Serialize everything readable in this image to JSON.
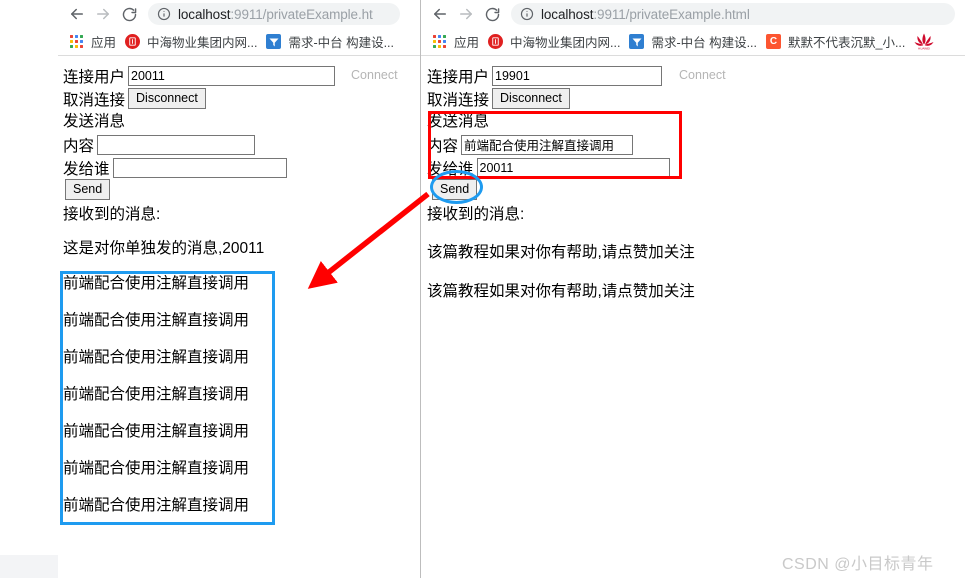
{
  "windows": {
    "left": {
      "nav": {
        "back_icon": "arrow-left-icon",
        "forward_icon": "arrow-right-icon",
        "reload_icon": "reload-icon"
      },
      "omnibox": {
        "info_icon": "info-circle-icon",
        "url_host": "localhost",
        "url_rest": ":9911/privateExample.ht"
      },
      "bookmarks": [
        {
          "icon": "apps-grid-icon",
          "label": "应用"
        },
        {
          "icon": "zhonghai-favicon",
          "label": "中海物业集团内网...",
          "letter": "",
          "color": "#e02020"
        },
        {
          "icon": "xuqiu-favicon",
          "label": "需求-中台 构建设...",
          "letter": "",
          "color": "#2f7fd1"
        }
      ],
      "page": {
        "connect_label": "连接用户",
        "connect_value": "20011",
        "connect_button": "Connect",
        "disconnect_label": "取消连接",
        "disconnect_button": "Disconnect",
        "send_section_label": "发送消息",
        "content_label": "内容",
        "content_value": "",
        "content_placeholder": "",
        "to_label": "发给谁",
        "to_value": "",
        "to_placeholder": "",
        "send_button": "Send",
        "received_label": "接收到的消息:",
        "first_message": "这是对你单独发的消息,20011",
        "boxed_messages": [
          "前端配合使用注解直接调用",
          "前端配合使用注解直接调用",
          "前端配合使用注解直接调用",
          "前端配合使用注解直接调用",
          "前端配合使用注解直接调用",
          "前端配合使用注解直接调用",
          "前端配合使用注解直接调用"
        ]
      }
    },
    "right": {
      "nav": {
        "back_icon": "arrow-left-icon",
        "forward_icon": "arrow-right-icon",
        "reload_icon": "reload-icon"
      },
      "omnibox": {
        "info_icon": "info-circle-icon",
        "url_host": "localhost",
        "url_rest": ":9911/privateExample.html"
      },
      "bookmarks": [
        {
          "icon": "apps-grid-icon",
          "label": "应用"
        },
        {
          "icon": "zhonghai-favicon",
          "label": "中海物业集团内网...",
          "letter": "",
          "color": "#e02020"
        },
        {
          "icon": "xuqiu-favicon",
          "label": "需求-中台 构建设...",
          "letter": "",
          "color": "#2f7fd1"
        },
        {
          "icon": "csdn-favicon",
          "label": "默默不代表沉默_小...",
          "letter": "C",
          "color": "#fc5531"
        },
        {
          "icon": "huawei-logo-icon",
          "label": "",
          "letter": "",
          "color": "#cf0a2c"
        }
      ],
      "page": {
        "connect_label": "连接用户",
        "connect_value": "19901",
        "connect_button": "Connect",
        "disconnect_label": "取消连接",
        "disconnect_button": "Disconnect",
        "send_section_label": "发送消息",
        "content_label": "内容",
        "content_value": "前端配合使用注解直接调用",
        "content_placeholder": "",
        "to_label": "发给谁",
        "to_value": "20011",
        "to_placeholder": "",
        "send_button": "Send",
        "received_label": "接收到的消息:",
        "messages": [
          "该篇教程如果对你有帮助,请点赞加关注",
          "该篇教程如果对你有帮助,请点赞加关注"
        ]
      }
    }
  },
  "annotations": {
    "blue_box_name": "received-messages-highlight",
    "red_box_name": "send-message-highlight",
    "ellipse_name": "send-button-highlight",
    "arrow_name": "flow-arrow",
    "blue_color": "#1e9bf0",
    "red_color": "#ff0000"
  },
  "watermark": {
    "text": "CSDN @小目标青年"
  }
}
